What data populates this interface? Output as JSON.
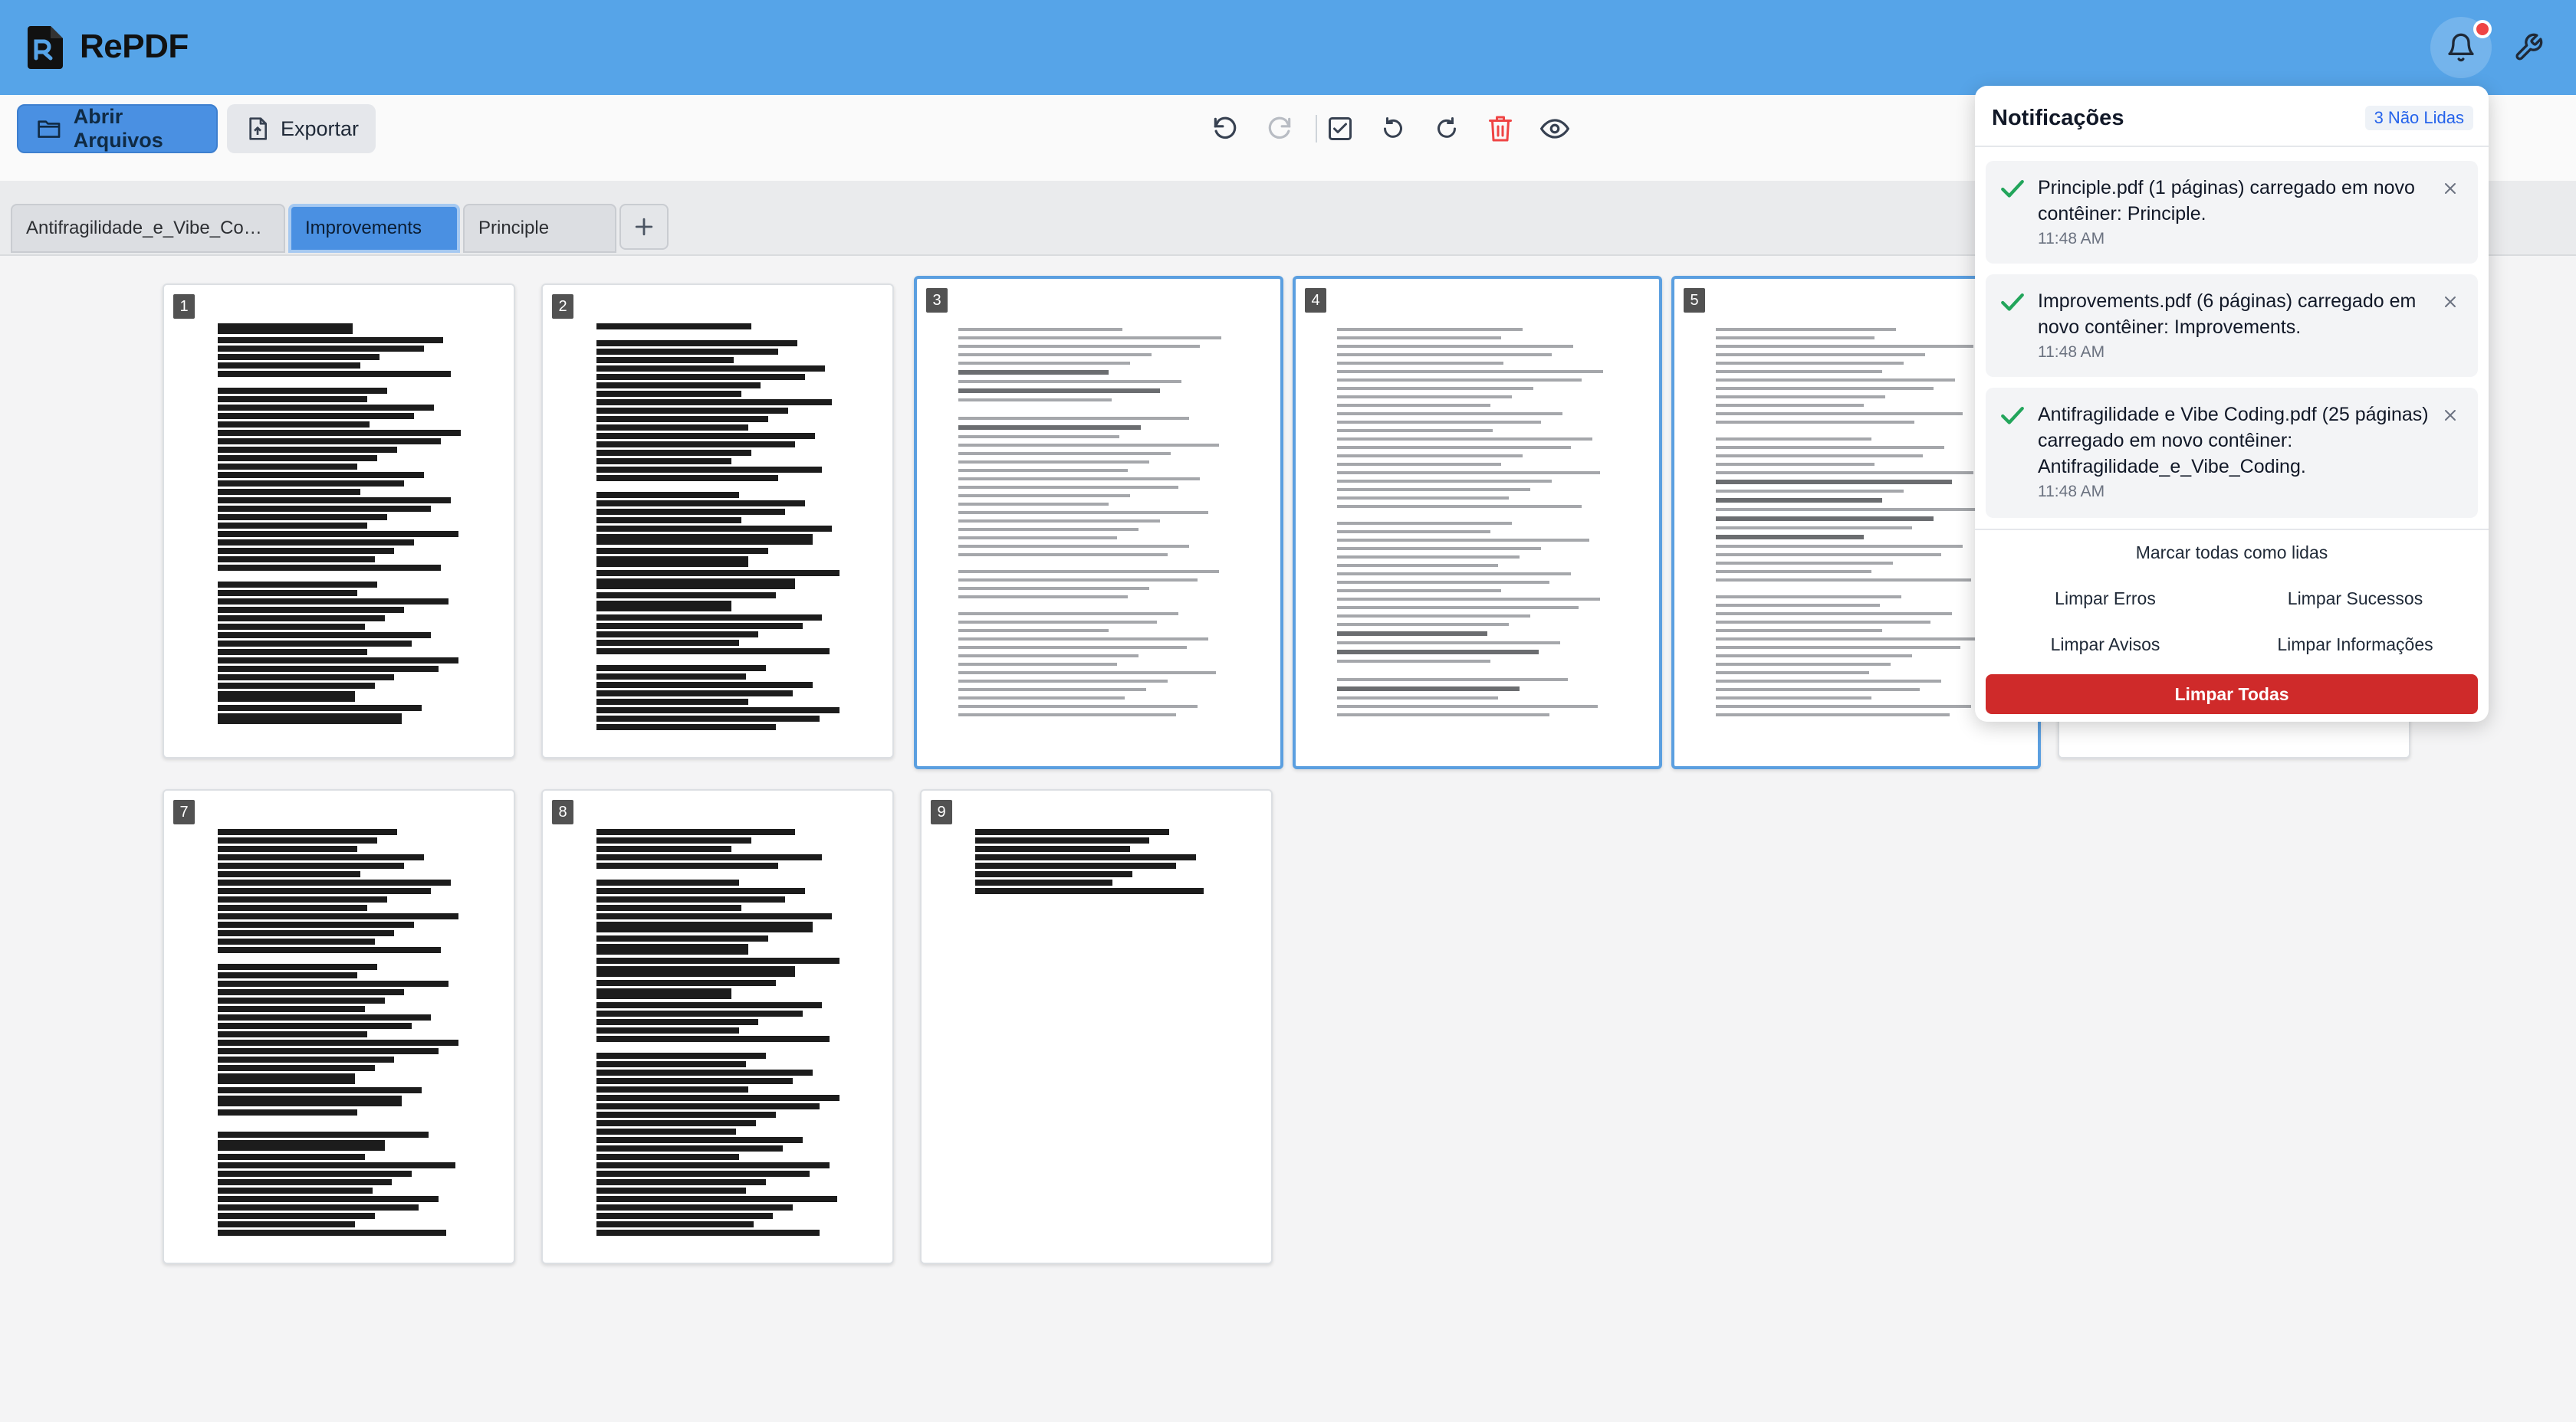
{
  "app": {
    "name": "RePDF"
  },
  "colors": {
    "header": "#56a4e8",
    "accent": "#4a90e2",
    "danger": "#cf2a2a",
    "success": "#22a55b"
  },
  "toolbar": {
    "open_label": "Abrir Arquivos",
    "export_label": "Exportar",
    "tools": [
      "undo-icon",
      "redo-icon",
      "select-all-icon",
      "rotate-left-icon",
      "rotate-right-icon",
      "delete-icon",
      "preview-icon"
    ]
  },
  "tabs": [
    {
      "label": "Antifragilidade_e_Vibe_Co…"
    },
    {
      "label": "Improvements"
    },
    {
      "label": "Principle"
    }
  ],
  "pages": [
    {
      "number": "1"
    },
    {
      "number": "2"
    },
    {
      "number": "3"
    },
    {
      "number": "4"
    },
    {
      "number": "5"
    },
    {
      "number": "7"
    },
    {
      "number": "8"
    },
    {
      "number": "9"
    }
  ],
  "notifications": {
    "title": "Notificações",
    "unread_badge": "3 Não Lidas",
    "items": [
      {
        "text": "Principle.pdf (1 páginas) carregado em novo contêiner: Principle.",
        "time": "11:48 AM"
      },
      {
        "text": "Improvements.pdf (6 páginas) carregado em novo contêiner: Improvements.",
        "time": "11:48 AM"
      },
      {
        "text": "Antifragilidade e Vibe Coding.pdf (25 páginas) carregado em novo contêiner: Antifragilidade_e_Vibe_Coding.",
        "time": "11:48 AM"
      }
    ],
    "mark_all": "Marcar todas como lidas",
    "clear_errors": "Limpar Erros",
    "clear_success": "Limpar Sucessos",
    "clear_warnings": "Limpar Avisos",
    "clear_info": "Limpar Informações",
    "clear_all": "Limpar Todas"
  }
}
